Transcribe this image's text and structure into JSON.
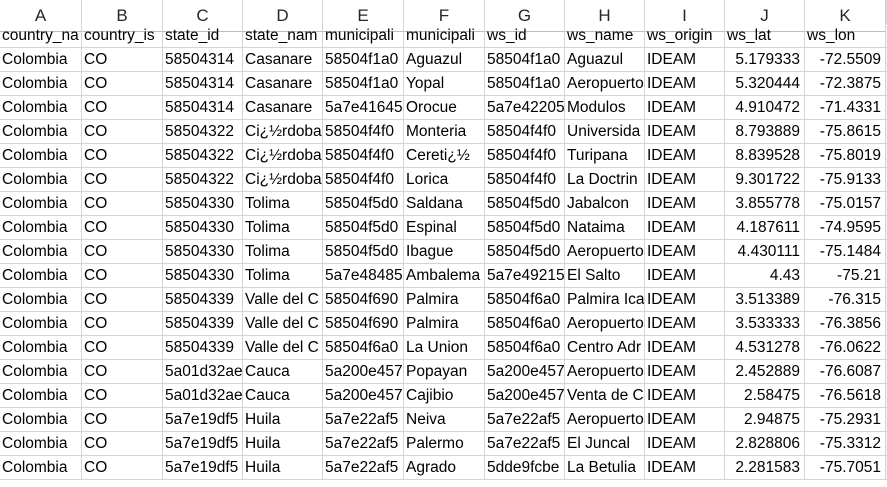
{
  "column_letters": [
    "A",
    "B",
    "C",
    "D",
    "E",
    "F",
    "G",
    "H",
    "I",
    "J",
    "K"
  ],
  "header_row": [
    "country_na",
    "country_is",
    "state_id",
    "state_nam",
    "municipali",
    "municipali",
    "ws_id",
    "ws_name",
    "ws_origin",
    "ws_lat",
    "ws_lon"
  ],
  "rows": [
    [
      "Colombia",
      "CO",
      "58504314",
      "Casanare",
      "58504f1a0",
      "Aguazul",
      "58504f1a0",
      "Aguazul",
      "IDEAM",
      "5.179333",
      "-72.5509"
    ],
    [
      "Colombia",
      "CO",
      "58504314",
      "Casanare",
      "58504f1a0",
      "Yopal",
      "58504f1a0",
      "Aeropuerto",
      "IDEAM",
      "5.320444",
      "-72.3875"
    ],
    [
      "Colombia",
      "CO",
      "58504314",
      "Casanare",
      "5a7e41645",
      "Orocue",
      "5a7e42205",
      "Modulos",
      "IDEAM",
      "4.910472",
      "-71.4331"
    ],
    [
      "Colombia",
      "CO",
      "58504322",
      "Ci¿½rdoba",
      "58504f4f0",
      "Monteria",
      "58504f4f0",
      "Universida",
      "IDEAM",
      "8.793889",
      "-75.8615"
    ],
    [
      "Colombia",
      "CO",
      "58504322",
      "Ci¿½rdoba",
      "58504f4f0",
      "Cereti¿½",
      "58504f4f0",
      "Turipana",
      "IDEAM",
      "8.839528",
      "-75.8019"
    ],
    [
      "Colombia",
      "CO",
      "58504322",
      "Ci¿½rdoba",
      "58504f4f0",
      "Lorica",
      "58504f4f0",
      "La Doctrin",
      "IDEAM",
      "9.301722",
      "-75.9133"
    ],
    [
      "Colombia",
      "CO",
      "58504330",
      "Tolima",
      "58504f5d0",
      "Saldana",
      "58504f5d0",
      "Jabalcon",
      "IDEAM",
      "3.855778",
      "-75.0157"
    ],
    [
      "Colombia",
      "CO",
      "58504330",
      "Tolima",
      "58504f5d0",
      "Espinal",
      "58504f5d0",
      "Nataima",
      "IDEAM",
      "4.187611",
      "-74.9595"
    ],
    [
      "Colombia",
      "CO",
      "58504330",
      "Tolima",
      "58504f5d0",
      "Ibague",
      "58504f5d0",
      "Aeropuerto",
      "IDEAM",
      "4.430111",
      "-75.1484"
    ],
    [
      "Colombia",
      "CO",
      "58504330",
      "Tolima",
      "5a7e48485",
      "Ambalema",
      "5a7e49215",
      "El Salto",
      "IDEAM",
      "4.43",
      "-75.21"
    ],
    [
      "Colombia",
      "CO",
      "58504339",
      "Valle del C",
      "58504f690",
      "Palmira",
      "58504f6a0",
      "Palmira Ica",
      "IDEAM",
      "3.513389",
      "-76.315"
    ],
    [
      "Colombia",
      "CO",
      "58504339",
      "Valle del C",
      "58504f690",
      "Palmira",
      "58504f6a0",
      "Aeropuerto",
      "IDEAM",
      "3.533333",
      "-76.3856"
    ],
    [
      "Colombia",
      "CO",
      "58504339",
      "Valle del C",
      "58504f6a0",
      "La Union",
      "58504f6a0",
      "Centro Adr",
      "IDEAM",
      "4.531278",
      "-76.0622"
    ],
    [
      "Colombia",
      "CO",
      "5a01d32ae",
      "Cauca",
      "5a200e457",
      "Popayan",
      "5a200e457",
      "Aeropuerto",
      "IDEAM",
      "2.452889",
      "-76.6087"
    ],
    [
      "Colombia",
      "CO",
      "5a01d32ae",
      "Cauca",
      "5a200e457",
      "Cajibio",
      "5a200e457",
      "Venta de C",
      "IDEAM",
      "2.58475",
      "-76.5618"
    ],
    [
      "Colombia",
      "CO",
      "5a7e19df5",
      "Huila",
      "5a7e22af5",
      "Neiva",
      "5a7e22af5",
      "Aeropuerto",
      "IDEAM",
      "2.94875",
      "-75.2931"
    ],
    [
      "Colombia",
      "CO",
      "5a7e19df5",
      "Huila",
      "5a7e22af5",
      "Palermo",
      "5a7e22af5",
      "El Juncal",
      "IDEAM",
      "2.828806",
      "-75.3312"
    ],
    [
      "Colombia",
      "CO",
      "5a7e19df5",
      "Huila",
      "5a7e22af5",
      "Agrado",
      "5dde9fcbe",
      "La Betulia",
      "IDEAM",
      "2.281583",
      "-75.7051"
    ]
  ],
  "numeric_columns": [
    9,
    10
  ]
}
